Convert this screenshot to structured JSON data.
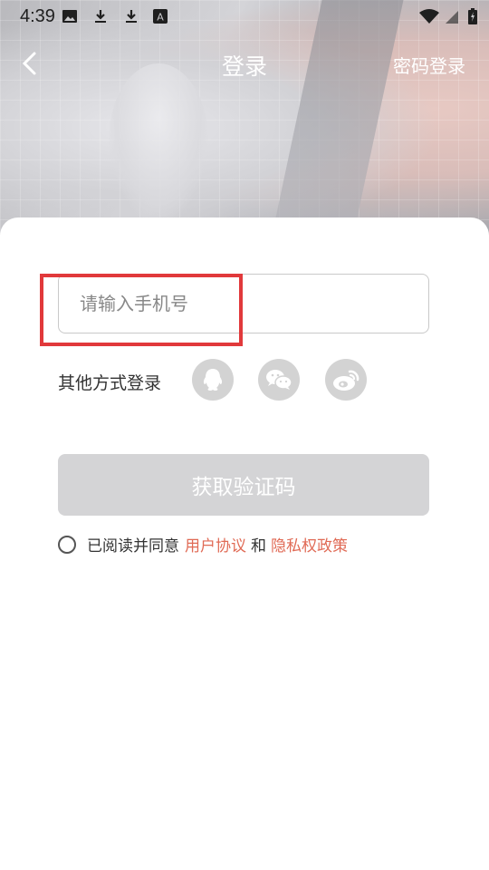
{
  "status_bar": {
    "time": "4:39",
    "icons_left": [
      "image-icon",
      "download-icon",
      "download-icon",
      "font-app-icon"
    ],
    "icons_right": [
      "wifi-icon",
      "signal-icon",
      "battery-icon"
    ]
  },
  "nav": {
    "title": "登录",
    "right_action": "密码登录",
    "back_icon": "chevron-left-icon"
  },
  "form": {
    "phone_placeholder": "请输入手机号",
    "phone_value": "",
    "other_methods_label": "其他方式登录",
    "social": [
      {
        "name": "qq",
        "icon": "qq-icon"
      },
      {
        "name": "wechat",
        "icon": "wechat-icon"
      },
      {
        "name": "weibo",
        "icon": "weibo-icon"
      }
    ],
    "submit_label": "获取验证码"
  },
  "agreement": {
    "prefix": "已阅读并同意",
    "user_agreement": "用户协议",
    "and": "和",
    "privacy_policy": "隐私权政策"
  },
  "colors": {
    "link": "#e06a55",
    "highlight": "#e1393b",
    "button_disabled": "#d4d4d6",
    "social_bg": "#d3d3d3"
  }
}
